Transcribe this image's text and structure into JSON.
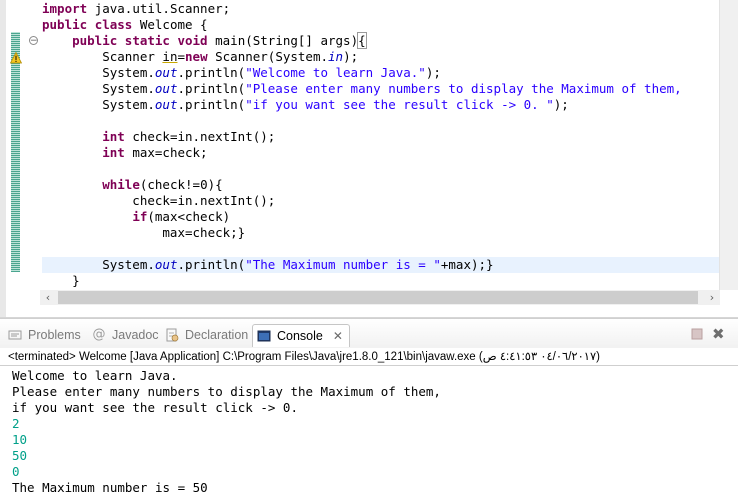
{
  "editor": {
    "lines": [
      {
        "parts": [
          {
            "t": "import ",
            "c": "kw"
          },
          {
            "t": "java.util.Scanner;",
            "c": ""
          }
        ]
      },
      {
        "parts": [
          {
            "t": "public ",
            "c": "kw"
          },
          {
            "t": "class ",
            "c": "kw"
          },
          {
            "t": "Welcome {",
            "c": ""
          }
        ]
      },
      {
        "parts": [
          {
            "t": "    ",
            "c": ""
          },
          {
            "t": "public ",
            "c": "kw"
          },
          {
            "t": "static ",
            "c": "kw"
          },
          {
            "t": "void ",
            "c": "kw"
          },
          {
            "t": "main(String[] args)",
            "c": ""
          },
          {
            "t": "{",
            "c": "box"
          }
        ]
      },
      {
        "parts": [
          {
            "t": "        Scanner ",
            "c": ""
          },
          {
            "t": "in",
            "c": "ul"
          },
          {
            "t": "=",
            "c": ""
          },
          {
            "t": "new ",
            "c": "kw"
          },
          {
            "t": "Scanner(System.",
            "c": ""
          },
          {
            "t": "in",
            "c": "fld"
          },
          {
            "t": ");",
            "c": ""
          }
        ]
      },
      {
        "parts": [
          {
            "t": "        System.",
            "c": ""
          },
          {
            "t": "out",
            "c": "fld"
          },
          {
            "t": ".println(",
            "c": ""
          },
          {
            "t": "\"Welcome to learn Java.\"",
            "c": "str"
          },
          {
            "t": ");",
            "c": ""
          }
        ]
      },
      {
        "parts": [
          {
            "t": "        System.",
            "c": ""
          },
          {
            "t": "out",
            "c": "fld"
          },
          {
            "t": ".println(",
            "c": ""
          },
          {
            "t": "\"Please enter many numbers to display the Maximum of them,",
            "c": "str"
          }
        ]
      },
      {
        "parts": [
          {
            "t": "        System.",
            "c": ""
          },
          {
            "t": "out",
            "c": "fld"
          },
          {
            "t": ".println(",
            "c": ""
          },
          {
            "t": "\"if you want see the result click -> 0. \"",
            "c": "str"
          },
          {
            "t": ");",
            "c": ""
          }
        ]
      },
      {
        "parts": []
      },
      {
        "parts": [
          {
            "t": "        ",
            "c": ""
          },
          {
            "t": "int ",
            "c": "kw"
          },
          {
            "t": "check=in.nextInt();",
            "c": ""
          }
        ]
      },
      {
        "parts": [
          {
            "t": "        ",
            "c": ""
          },
          {
            "t": "int ",
            "c": "kw"
          },
          {
            "t": "max=check;",
            "c": ""
          }
        ]
      },
      {
        "parts": []
      },
      {
        "parts": [
          {
            "t": "        ",
            "c": ""
          },
          {
            "t": "while",
            "c": "kw"
          },
          {
            "t": "(check!=0){",
            "c": ""
          }
        ]
      },
      {
        "parts": [
          {
            "t": "            check=in.nextInt();",
            "c": ""
          }
        ]
      },
      {
        "parts": [
          {
            "t": "            ",
            "c": ""
          },
          {
            "t": "if",
            "c": "kw"
          },
          {
            "t": "(max<check)",
            "c": ""
          }
        ]
      },
      {
        "parts": [
          {
            "t": "                max=check;}",
            "c": ""
          }
        ]
      },
      {
        "parts": []
      },
      {
        "parts": [
          {
            "t": "        System.",
            "c": ""
          },
          {
            "t": "out",
            "c": "fld"
          },
          {
            "t": ".println(",
            "c": ""
          },
          {
            "t": "\"The Maximum number is = \"",
            "c": "str"
          },
          {
            "t": "+max);}",
            "c": ""
          }
        ]
      },
      {
        "parts": [
          {
            "t": "    }",
            "c": ""
          }
        ]
      }
    ]
  },
  "tabs": {
    "problems": "Problems",
    "javadoc": "Javadoc",
    "declaration": "Declaration",
    "console": "Console"
  },
  "console": {
    "status": "<terminated> Welcome [Java Application] C:\\Program Files\\Java\\jre1.8.0_121\\bin\\javaw.exe (٠٤/٠٦/٢٠١٧ ٤:٤١:٥٣ ص)",
    "output": [
      {
        "text": "Welcome to learn Java.",
        "input": false
      },
      {
        "text": "Please enter many numbers to display the Maximum of them,",
        "input": false
      },
      {
        "text": "if you want see the result click -> 0.",
        "input": false
      },
      {
        "text": "2",
        "input": true
      },
      {
        "text": "10",
        "input": true
      },
      {
        "text": "50",
        "input": true
      },
      {
        "text": "0",
        "input": true
      },
      {
        "text": "The Maximum number is = 50",
        "input": false
      }
    ]
  },
  "colors": {
    "keyword": "#7f0055",
    "string": "#2a00ff",
    "field": "#0000c0",
    "console_input": "#00a089",
    "current_line": "#e8f2fe"
  }
}
